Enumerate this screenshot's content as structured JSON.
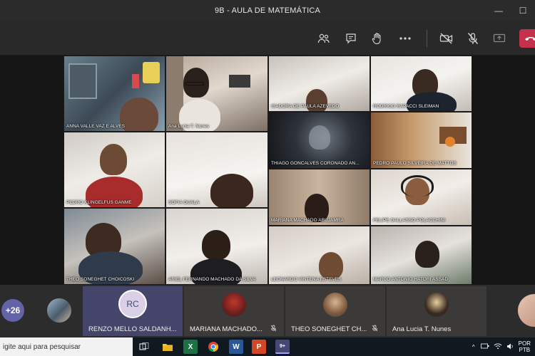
{
  "window": {
    "title": "9B - AULA DE MATEMÁTICA"
  },
  "window_controls": {
    "minimize": "—",
    "maximize": "☐",
    "close": "✕"
  },
  "toolbar": {
    "icons": [
      "participants-icon",
      "chat-icon",
      "raise-hand-icon",
      "more-actions-icon",
      "camera-off-icon",
      "mic-off-icon",
      "share-screen-icon",
      "hang-up-icon"
    ]
  },
  "video_tiles": [
    {
      "name": "ANNA VALLE VAZ E ALVES"
    },
    {
      "name": "Ana Lucia T. Nunes"
    },
    {
      "name": "ISADORA DE PAULA AZEVEDO"
    },
    {
      "name": "RODRIGO RAPACCI SLEIMAN"
    },
    {
      "name": "THIAGO GONCALVES CORONADO AN..."
    },
    {
      "name": "PEDRO PAULO SILVEIRA DE MATTOS"
    },
    {
      "name": "PEDRO KLINGELFUS GANME"
    },
    {
      "name": "SOFIA GUALA"
    },
    {
      "name": "MARIANA MACHADO ABUJAMRA"
    },
    {
      "name": "FELIPE GALLASSO POLACCHINI"
    },
    {
      "name": "THEO SONEGHET CHOICOSKI"
    },
    {
      "name": "ARIEL FERNANDO MACHADO DA SILVA"
    },
    {
      "name": "LEONARDO VINTENA ESTEVES"
    },
    {
      "name": "MARCO ANTONIO HATORI ASSAD"
    }
  ],
  "participant_strip": {
    "more_count": "+26",
    "participants": [
      {
        "initials": "RC",
        "name": "RENZO MELLO SALDANH..."
      },
      {
        "name": "MARIANA MACHADO..."
      },
      {
        "name": "THEO SONEGHET CH..."
      },
      {
        "name": "Ana Lucia T. Nunes"
      }
    ]
  },
  "taskbar": {
    "search_placeholder": "igite aqui para pesquisar",
    "apps": [
      "search-icon",
      "task-view-icon",
      "file-explorer-icon",
      "excel-icon",
      "chrome-icon",
      "word-icon",
      "powerpoint-icon",
      "teams-icon"
    ],
    "excel_letter": "X",
    "word_letter": "W",
    "powerpoint_letter": "P",
    "teams_badge": "9+",
    "language_line1": "POR",
    "language_line2": "PTB"
  },
  "colors": {
    "accent": "#6264a7",
    "hangup": "#c4314b"
  }
}
